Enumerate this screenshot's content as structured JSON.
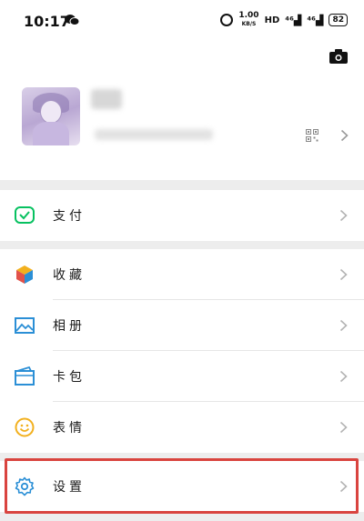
{
  "status_bar": {
    "time": "10:17",
    "speed_value": "1.00",
    "speed_unit": "KB/S",
    "hd": "HD",
    "signal1": "⁴⁶",
    "signal2": "⁴⁶",
    "battery": "82"
  },
  "profile": {
    "icons": [
      "camera-icon",
      "qr-code-icon",
      "chevron-right-icon"
    ]
  },
  "menu": {
    "pay": "支付",
    "favorites": "收藏",
    "album": "相册",
    "cards": "卡包",
    "stickers": "表情",
    "settings": "设置"
  },
  "colors": {
    "pay_green": "#07c160",
    "blue_icon": "#2b8fd6",
    "sticker_yellow": "#f2b01e",
    "highlight_red": "#d9443f"
  }
}
